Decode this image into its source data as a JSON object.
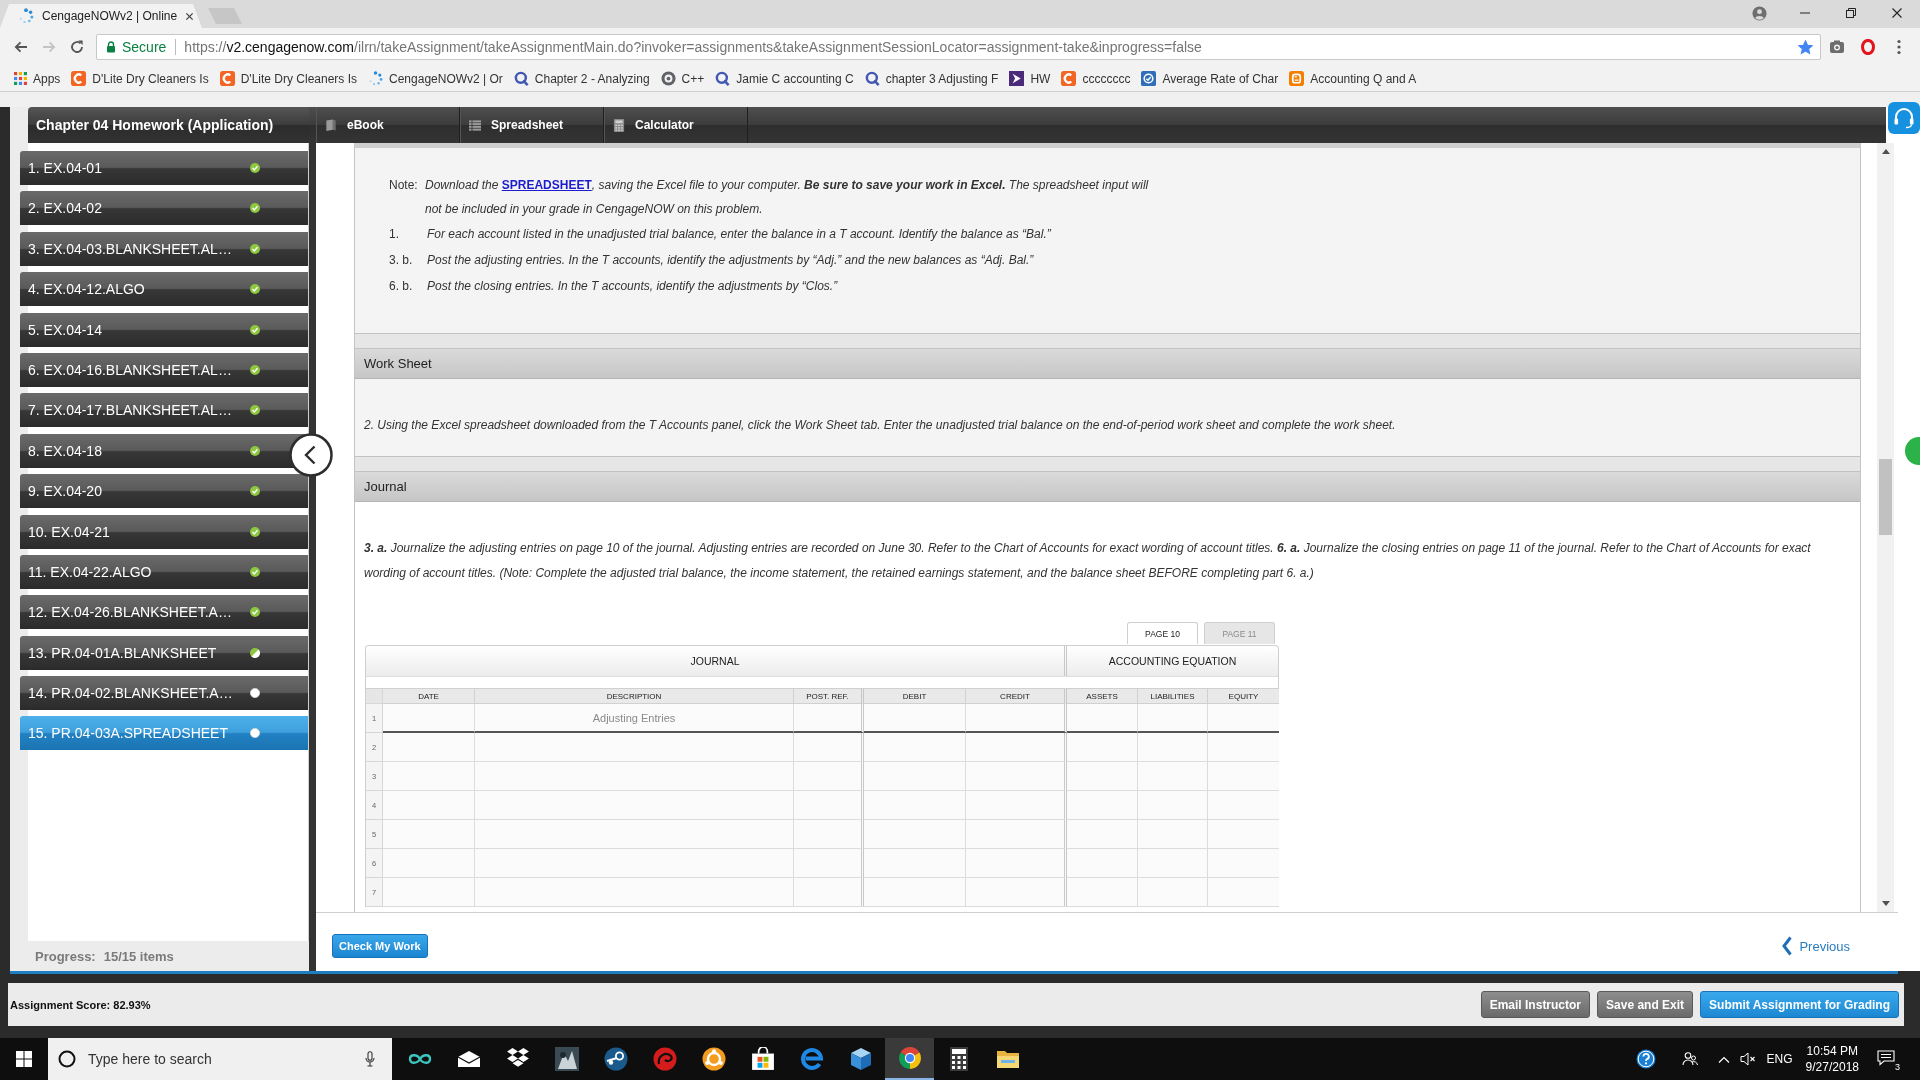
{
  "browser": {
    "tab": {
      "title": "CengageNOWv2 | Online"
    },
    "address": {
      "security": "Secure",
      "scheme": "https://",
      "host": "v2.cengagenow.com",
      "path": "/ilrn/takeAssignment/takeAssignmentMain.do?invoker=assignments&takeAssignmentSessionLocator=assignment-take&inprogress=false",
      "bookmarked": true
    },
    "bookmarks": [
      {
        "label": "Apps",
        "kind": "apps"
      },
      {
        "label": "D'Lite Dry Cleaners Is",
        "kind": "tile"
      },
      {
        "label": "D'Lite Dry Cleaners Is",
        "kind": "tile"
      },
      {
        "label": "CengageNOWv2 | Or",
        "kind": "spinner"
      },
      {
        "label": "Chapter 2 - Analyzing",
        "kind": "ring"
      },
      {
        "label": "C++",
        "kind": "gear"
      },
      {
        "label": "Jamie C accounting C",
        "kind": "ring"
      },
      {
        "label": "chapter 3 Adjusting F",
        "kind": "ring"
      },
      {
        "label": "HW",
        "kind": "play"
      },
      {
        "label": "cccccccc",
        "kind": "tile"
      },
      {
        "label": "Average Rate of Char",
        "kind": "badge"
      },
      {
        "label": "Accounting Q and A",
        "kind": "blog"
      }
    ]
  },
  "assignment": {
    "title": "Chapter 04 Homework (Application)",
    "tools": [
      {
        "label": "eBook",
        "kind": "book"
      },
      {
        "label": "Spreadsheet",
        "kind": "grid"
      },
      {
        "label": "Calculator",
        "kind": "calculator"
      }
    ],
    "items": [
      {
        "label": "1. EX.04-01",
        "kind": "complete",
        "selected": false
      },
      {
        "label": "2. EX.04-02",
        "kind": "complete",
        "selected": false
      },
      {
        "label": "3. EX.04-03.BLANKSHEET.AL…",
        "kind": "complete",
        "selected": false
      },
      {
        "label": "4. EX.04-12.ALGO",
        "kind": "complete",
        "selected": false
      },
      {
        "label": "5. EX.04-14",
        "kind": "complete",
        "selected": false
      },
      {
        "label": "6. EX.04-16.BLANKSHEET.AL…",
        "kind": "complete",
        "selected": false
      },
      {
        "label": "7. EX.04-17.BLANKSHEET.AL…",
        "kind": "complete",
        "selected": false
      },
      {
        "label": "8. EX.04-18",
        "kind": "complete",
        "selected": false
      },
      {
        "label": "9. EX.04-20",
        "kind": "complete",
        "selected": false
      },
      {
        "label": "10. EX.04-21",
        "kind": "complete",
        "selected": false
      },
      {
        "label": "11. EX.04-22.ALGO",
        "kind": "complete",
        "selected": false
      },
      {
        "label": "12. EX.04-26.BLANKSHEET.A…",
        "kind": "complete",
        "selected": false
      },
      {
        "label": "13. PR.04-01A.BLANKSHEET",
        "kind": "partial",
        "selected": false
      },
      {
        "label": "14. PR.04-02.BLANKSHEET.A…",
        "kind": "open",
        "selected": false
      },
      {
        "label": "15. PR.04-03A.SPREADSHEET",
        "kind": "open",
        "selected": true
      }
    ],
    "progress": {
      "label": "Progress:",
      "value": "15/15 items"
    }
  },
  "instructions": {
    "note": {
      "label": "Note:",
      "before": "Download the ",
      "link": "SPREADSHEET",
      "after": ", saving the Excel file to your computer. **Be sure to save your work in Excel.** The spreadsheet input will not be included in your grade in CengageNOW on this problem."
    },
    "steps": [
      {
        "number": "1.",
        "text": "For each account listed in the unadjusted trial balance, enter the balance in a T account. Identify the balance as “Bal.”"
      },
      {
        "number": "3. b.",
        "text": "Post the adjusting entries. In the T accounts, identify the adjustments by “Adj.” and the new balances as “Adj. Bal.”"
      },
      {
        "number": "6. b.",
        "text": "Post the closing entries. In the T accounts, identify the adjustments by “Clos.”"
      }
    ]
  },
  "worksheet": {
    "title": "Work Sheet",
    "text": "2. Using the Excel spreadsheet downloaded from the T Accounts panel, click the Work Sheet tab. Enter the unadjusted trial balance on the end-of-period work sheet and complete the work sheet."
  },
  "journal": {
    "title": "Journal",
    "text": "**3. a.** Journalize the adjusting entries on page 10 of the journal. Adjusting entries are recorded on June 30. Refer to the Chart of Accounts for exact wording of account titles. **6. a.** Journalize the closing entries on page 11 of the journal. Refer to the Chart of Accounts for exact wording of account titles. (Note: Complete the adjusted trial balance, the income statement, the retained earnings statement, and the balance sheet BEFORE completing part 6. a.)",
    "pages": [
      {
        "label": "PAGE 10",
        "selected": true
      },
      {
        "label": "PAGE 11",
        "selected": false
      }
    ],
    "groups": [
      {
        "label": "JOURNAL",
        "columns": [
          "DATE",
          "DESCRIPTION",
          "POST. REF.",
          "DEBIT",
          "CREDIT"
        ]
      },
      {
        "label": "ACCOUNTING EQUATION",
        "columns": [
          "ASSETS",
          "LIABILITIES",
          "EQUITY"
        ]
      }
    ],
    "rows": [
      {
        "number": "1",
        "description": "Adjusting Entries"
      },
      {
        "number": "2"
      },
      {
        "number": "3"
      },
      {
        "number": "4"
      },
      {
        "number": "5"
      },
      {
        "number": "6"
      },
      {
        "number": "7"
      }
    ]
  },
  "actions": {
    "check": "Check My Work",
    "previous": "Previous"
  },
  "footer": {
    "score": "Assignment Score: 82.93%",
    "buttons": [
      {
        "label": "Email Instructor",
        "kind": "secondary"
      },
      {
        "label": "Save and Exit",
        "kind": "secondary"
      },
      {
        "label": "Submit Assignment for Grading",
        "kind": "primary"
      }
    ]
  },
  "taskbar": {
    "search": {
      "placeholder": "Type here to search"
    },
    "apps": [
      {
        "kind": "infinity",
        "active": false
      },
      {
        "kind": "envelope",
        "active": false
      },
      {
        "kind": "box",
        "active": false
      },
      {
        "kind": "picture",
        "active": false
      },
      {
        "kind": "piston",
        "active": false
      },
      {
        "kind": "swirl",
        "active": false
      },
      {
        "kind": "gear",
        "active": false
      },
      {
        "kind": "bag",
        "active": false
      },
      {
        "kind": "swoosh",
        "active": false
      },
      {
        "kind": "cube",
        "active": false
      },
      {
        "kind": "wheel",
        "active": true
      },
      {
        "kind": "calculator",
        "active": false
      },
      {
        "kind": "folder",
        "active": false
      }
    ],
    "tray": {
      "language": "ENG",
      "time": "10:54 PM",
      "date": "9/27/2018",
      "notifications": "3"
    }
  }
}
